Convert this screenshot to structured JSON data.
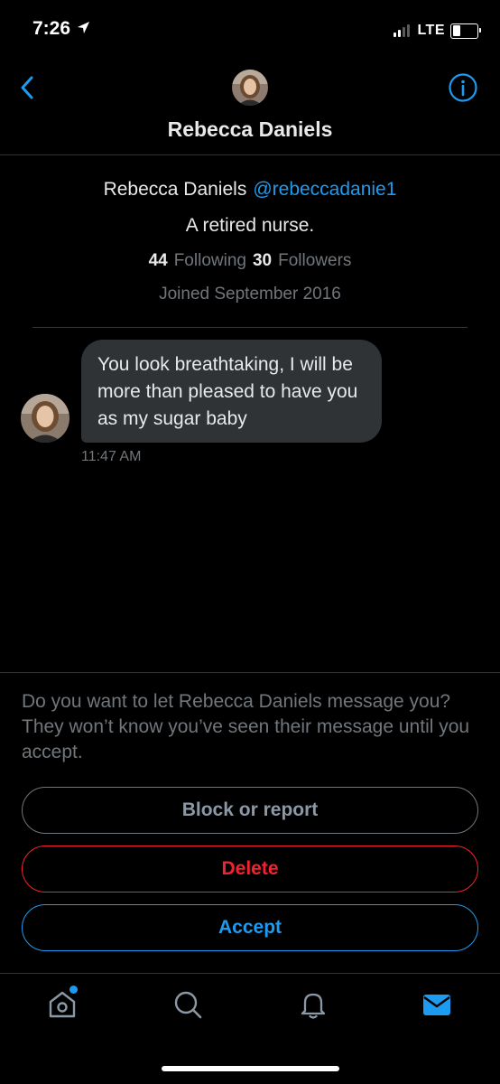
{
  "status_bar": {
    "time": "7:26",
    "network": "LTE",
    "icons": [
      "location-arrow-icon",
      "signal-icon",
      "battery-icon"
    ]
  },
  "header": {
    "title": "Rebecca Daniels",
    "back_icon": "chevron-left-icon",
    "info_icon": "info-icon"
  },
  "profile": {
    "name": "Rebecca Daniels",
    "handle": "@rebeccadanie1",
    "bio": "A retired nurse.",
    "following_count": "44",
    "following_label": "Following",
    "followers_count": "30",
    "followers_label": "Followers",
    "joined": "Joined September 2016"
  },
  "message": {
    "text": "You look breathtaking, I will be more than pleased to have you as my sugar baby",
    "time": "11:47 AM"
  },
  "request": {
    "prompt": "Do you want to let Rebecca Daniels message you? They won’t know you’ve seen their message until you accept.",
    "block_label": "Block or report",
    "delete_label": "Delete",
    "accept_label": "Accept"
  },
  "tab_bar": {
    "items": [
      "home-icon",
      "search-icon",
      "bell-icon",
      "mail-icon"
    ],
    "active": "mail-icon"
  },
  "colors": {
    "background": "#000000",
    "accent": "#1d9bf0",
    "danger": "#f4212e",
    "muted": "#71767b",
    "bubble": "#2f3336"
  }
}
